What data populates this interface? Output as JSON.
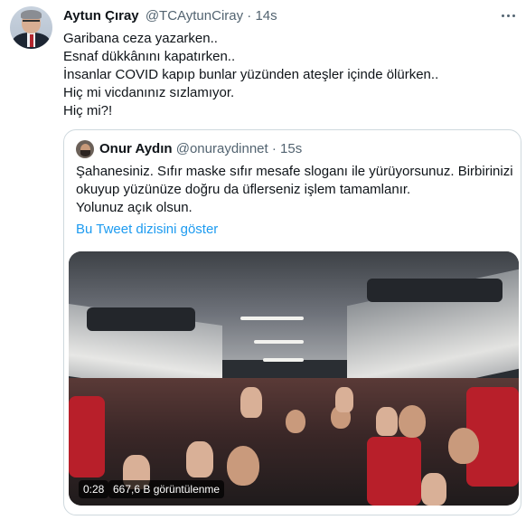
{
  "tweet": {
    "author_name": "Aytun Çıray",
    "author_handle": "@TCAytunCiray",
    "separator": "·",
    "time": "14s",
    "more_icon": "more-dots-icon",
    "lines": [
      "Garibana ceza yazarken..",
      "Esnaf dükkânını kapatırken..",
      "İnsanlar COVID kapıp bunlar yüzünden ateşler içinde ölürken..",
      "Hiç mi vicdanınız sızlamıyor.",
      "Hiç mi?!"
    ]
  },
  "quote": {
    "author_name": "Onur Aydın",
    "author_handle": "@onuraydinnet",
    "separator": "·",
    "time": "15s",
    "lines": [
      "Şahanesiniz. Sıfır maske sıfır mesafe sloganı ile yürüyorsunuz. Birbirinizi",
      "okuyup yüzünüze doğru da üflerseniz işlem tamamlanır.",
      "Yolunuz açık olsun."
    ],
    "show_thread_link": "Bu Tweet dizisini göster",
    "link_color": "#1d9bf0",
    "video": {
      "duration": "0:28",
      "views": "667,6 B görüntülenme"
    }
  }
}
